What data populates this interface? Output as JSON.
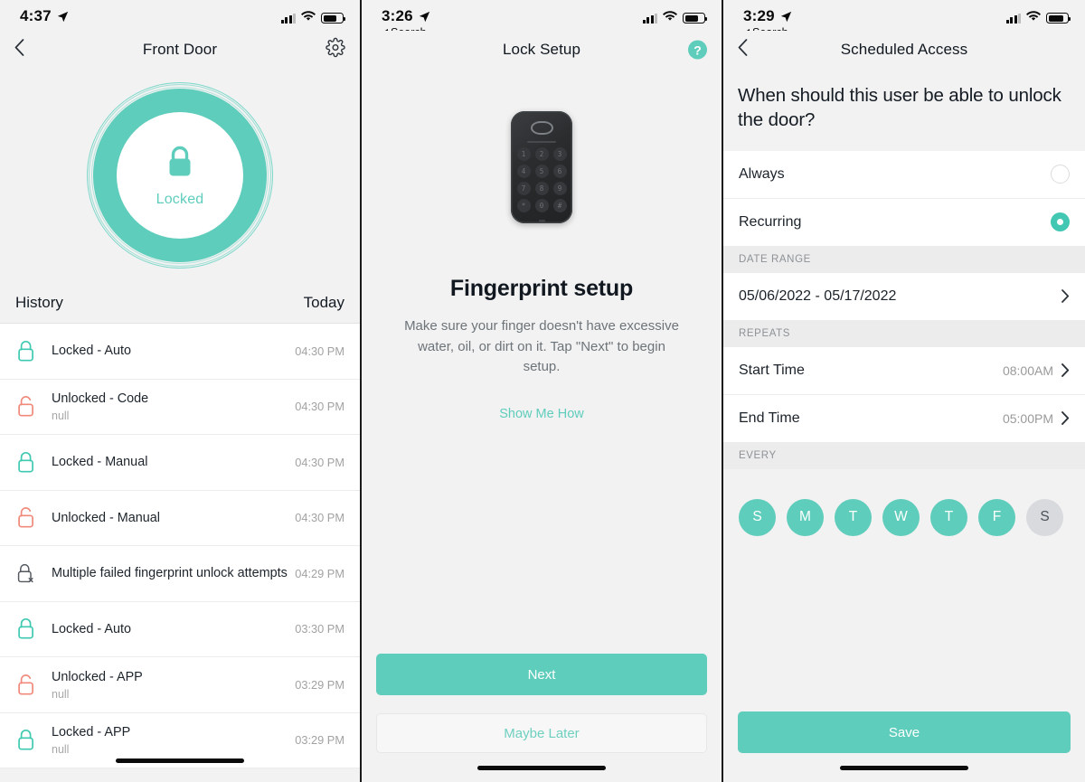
{
  "theme": {
    "accent": "#5fcdbc",
    "accent_dark": "#41c7b2",
    "unlock_icon": "#f0897a",
    "bg": "#f2f2f2",
    "text": "#141b23"
  },
  "panel1": {
    "status": {
      "time": "4:37",
      "location_icon": "location-arrow-icon",
      "signal_icon": "cellular-signal-icon",
      "wifi_icon": "wifi-icon",
      "battery_icon": "battery-icon"
    },
    "nav": {
      "back_icon": "chevron-left-icon",
      "title": "Front Door",
      "settings_icon": "gear-icon"
    },
    "dial": {
      "state_label": "Locked",
      "lock_icon": "padlock-closed-icon"
    },
    "history": {
      "title": "History",
      "range": "Today"
    },
    "history_items": [
      {
        "title": "Locked - Auto",
        "sub": "",
        "time": "04:30 PM",
        "icon": "padlock-closed-icon",
        "icon_state": "locked"
      },
      {
        "title": "Unlocked - Code",
        "sub": "null",
        "time": "04:30 PM",
        "icon": "padlock-open-icon",
        "icon_state": "unlocked"
      },
      {
        "title": "Locked - Manual",
        "sub": "",
        "time": "04:30 PM",
        "icon": "padlock-closed-icon",
        "icon_state": "locked"
      },
      {
        "title": "Unlocked - Manual",
        "sub": "",
        "time": "04:30 PM",
        "icon": "padlock-open-icon",
        "icon_state": "unlocked"
      },
      {
        "title": "Multiple failed fingerprint unlock attempts",
        "sub": "",
        "time": "04:29 PM",
        "icon": "padlock-failed-icon",
        "icon_state": "failed"
      },
      {
        "title": "Locked - Auto",
        "sub": "",
        "time": "03:30 PM",
        "icon": "padlock-closed-icon",
        "icon_state": "locked"
      },
      {
        "title": "Unlocked - APP",
        "sub": "null",
        "time": "03:29 PM",
        "icon": "padlock-open-icon",
        "icon_state": "unlocked"
      },
      {
        "title": "Locked - APP",
        "sub": "null",
        "time": "03:29 PM",
        "icon": "padlock-closed-icon",
        "icon_state": "locked"
      }
    ]
  },
  "panel2": {
    "status": {
      "time": "3:26",
      "back_app": "Search",
      "location_icon": "location-arrow-icon"
    },
    "nav": {
      "title": "Lock Setup",
      "help_icon": "help-circle-icon",
      "help_label": "?"
    },
    "device": {
      "name": "smart-lock-keypad",
      "keys": [
        "1",
        "2",
        "3",
        "4",
        "5",
        "6",
        "7",
        "8",
        "9",
        "*",
        "0",
        "#"
      ]
    },
    "title": "Fingerprint setup",
    "description": "Make sure your finger doesn't have excessive water, oil, or dirt on it. Tap \"Next\" to begin setup.",
    "link": "Show Me How",
    "primary_button": "Next",
    "secondary_button": "Maybe Later"
  },
  "panel3": {
    "status": {
      "time": "3:29",
      "back_app": "Search",
      "location_icon": "location-arrow-icon"
    },
    "nav": {
      "back_icon": "chevron-left-icon",
      "title": "Scheduled Access"
    },
    "question": "When should this user be able to unlock the door?",
    "options": [
      {
        "label": "Always",
        "selected": false
      },
      {
        "label": "Recurring",
        "selected": true
      }
    ],
    "date_range_header": "DATE RANGE",
    "date_range_value": "05/06/2022 - 05/17/2022",
    "repeats_header": "REPEATS",
    "rows": [
      {
        "label": "Start Time",
        "value": "08:00AM"
      },
      {
        "label": "End Time",
        "value": "05:00PM"
      }
    ],
    "every_header": "EVERY",
    "days": [
      {
        "letter": "S",
        "selected": true
      },
      {
        "letter": "M",
        "selected": true
      },
      {
        "letter": "T",
        "selected": true
      },
      {
        "letter": "W",
        "selected": true
      },
      {
        "letter": "T",
        "selected": true
      },
      {
        "letter": "F",
        "selected": true
      },
      {
        "letter": "S",
        "selected": false
      }
    ],
    "save_button": "Save"
  }
}
